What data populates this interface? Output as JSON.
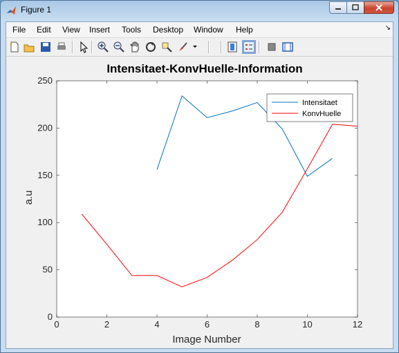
{
  "window": {
    "title": "Figure 1"
  },
  "menu": [
    {
      "key": "file",
      "label": "File"
    },
    {
      "key": "edit",
      "label": "Edit"
    },
    {
      "key": "view",
      "label": "View"
    },
    {
      "key": "insert",
      "label": "Insert"
    },
    {
      "key": "tools",
      "label": "Tools"
    },
    {
      "key": "desktop",
      "label": "Desktop"
    },
    {
      "key": "window",
      "label": "Window"
    },
    {
      "key": "help",
      "label": "Help"
    }
  ],
  "toolbar_icons": [
    "new-figure-icon",
    "open-file-icon",
    "save-icon",
    "print-icon",
    "pointer-icon",
    "zoom-in-icon",
    "zoom-out-icon",
    "pan-icon",
    "rotate-3d-icon",
    "data-cursor-icon",
    "brush-icon",
    "link-plot-icon",
    "colorbar-icon",
    "legend-icon",
    "hide-plot-tools-icon",
    "show-plot-tools-icon"
  ],
  "colors": {
    "series1": "#0072bd",
    "series2": "#ff0000",
    "axes_bg": "#ffffff",
    "figure_bg": "#f0f0f0"
  },
  "chart_data": {
    "type": "line",
    "title": "Intensitaet-KonvHuelle-Information",
    "xlabel": "Image Number",
    "ylabel": "a.u",
    "xlim": [
      0,
      12
    ],
    "ylim": [
      0,
      250
    ],
    "xticks": [
      "0",
      "2",
      "4",
      "6",
      "8",
      "10",
      "12"
    ],
    "yticks": [
      "0",
      "50",
      "100",
      "150",
      "200",
      "250"
    ],
    "grid": false,
    "legend_position": "top-right",
    "series": [
      {
        "name": "Intensitaet",
        "color": "#0072bd",
        "x": [
          4,
          5,
          6,
          7,
          8,
          9,
          10,
          11
        ],
        "y": [
          156,
          234,
          211,
          218,
          227,
          199,
          149,
          168
        ]
      },
      {
        "name": "KonvHuelle",
        "color": "#ff0000",
        "x": [
          1,
          2,
          3,
          4,
          5,
          6,
          7,
          8,
          9,
          10,
          11,
          12
        ],
        "y": [
          109,
          77,
          44,
          44,
          32,
          42,
          60,
          82,
          111,
          157,
          204,
          202
        ]
      }
    ]
  }
}
